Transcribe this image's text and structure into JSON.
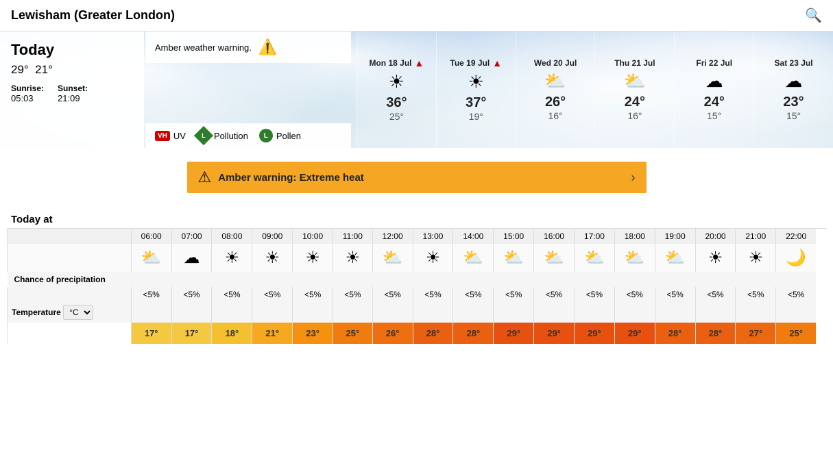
{
  "header": {
    "title": "Lewisham (Greater London)",
    "search_label": "search"
  },
  "today": {
    "label": "Today",
    "high": "29°",
    "low": "21°",
    "sunrise_label": "Sunrise:",
    "sunrise": "05:03",
    "sunset_label": "Sunset:",
    "sunset": "21:09"
  },
  "warning_card": {
    "text": "Amber weather warning.",
    "icon": "⚠"
  },
  "indicators": {
    "uv_label": "UV",
    "uv_badge": "VH",
    "pollution_label": "Pollution",
    "pollution_badge": "L",
    "pollen_label": "Pollen",
    "pollen_badge": "L"
  },
  "forecast_days": [
    {
      "label": "Mon 18 Jul",
      "alert": true,
      "high": "36°",
      "low": "25°",
      "icon": "☀"
    },
    {
      "label": "Tue 19 Jul",
      "alert": true,
      "high": "37°",
      "low": "19°",
      "icon": "☀"
    },
    {
      "label": "Wed 20 Jul",
      "alert": false,
      "high": "26°",
      "low": "16°",
      "icon": "⛅"
    },
    {
      "label": "Thu 21 Jul",
      "alert": false,
      "high": "24°",
      "low": "16°",
      "icon": "⛅"
    },
    {
      "label": "Fri 22 Jul",
      "alert": false,
      "high": "24°",
      "low": "15°",
      "icon": "☁"
    },
    {
      "label": "Sat 23 Jul",
      "alert": false,
      "high": "23°",
      "low": "15°",
      "icon": "☁"
    }
  ],
  "amber_bar": {
    "text": "Amber warning: Extreme heat",
    "icon": "⚠",
    "arrow": "›"
  },
  "today_at": {
    "label": "Today at"
  },
  "hours": [
    "06:00",
    "07:00",
    "08:00",
    "09:00",
    "10:00",
    "11:00",
    "12:00",
    "13:00",
    "14:00",
    "15:00",
    "16:00",
    "17:00",
    "18:00",
    "19:00",
    "20:00",
    "21:00",
    "22:00"
  ],
  "hour_icons": [
    "⛅",
    "☁",
    "☀",
    "☀",
    "☀",
    "☀",
    "⛅",
    "☀",
    "⛅",
    "⛅",
    "⛅",
    "⛅",
    "⛅",
    "⛅",
    "☀",
    "☀",
    "🌙"
  ],
  "precip_label": "Chance of precipitation",
  "precip_values": [
    "<5%",
    "<5%",
    "<5%",
    "<5%",
    "<5%",
    "<5%",
    "<5%",
    "<5%",
    "<5%",
    "<5%",
    "<5%",
    "<5%",
    "<5%",
    "<5%",
    "<5%",
    "<5%",
    "<5%"
  ],
  "temp_unit_label": "Temperature",
  "temp_unit_value": "°C ▾",
  "temp_values": [
    "17°",
    "17°",
    "18°",
    "21°",
    "23°",
    "25°",
    "26°",
    "28°",
    "28°",
    "29°",
    "29°",
    "29°",
    "29°",
    "28°",
    "28°",
    "27°",
    "25°"
  ],
  "temp_classes": [
    "temp-17",
    "temp-17",
    "temp-18",
    "temp-21",
    "temp-23",
    "temp-25",
    "temp-26",
    "temp-28",
    "temp-28",
    "temp-29",
    "temp-29",
    "temp-29",
    "temp-29",
    "temp-28",
    "temp-28",
    "temp-27",
    "temp-25"
  ]
}
